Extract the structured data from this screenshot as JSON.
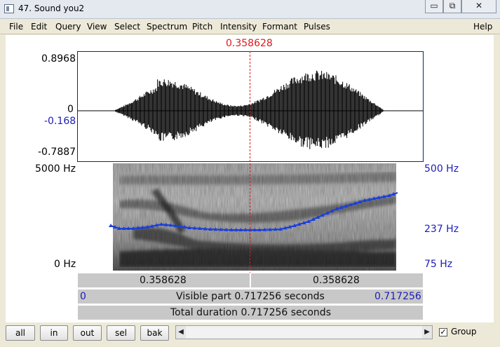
{
  "window": {
    "title": "47. Sound you2",
    "controls": [
      "▭",
      "⧉",
      "✕"
    ]
  },
  "menu": {
    "items": [
      "File",
      "Edit",
      "Query",
      "View",
      "Select",
      "Spectrum",
      "Pitch",
      "Intensity",
      "Formant",
      "Pulses"
    ],
    "help": "Help"
  },
  "cursor": {
    "time_label": "0.358628"
  },
  "waveform": {
    "max_label": "0.8968",
    "zero_label": "0",
    "cursor_value_label": "-0.168",
    "min_label": "-0.7887"
  },
  "spectrogram": {
    "freq_top_label": "5000 Hz",
    "freq_bottom_label": "0 Hz"
  },
  "pitch": {
    "top_label": "500 Hz",
    "mid_label": "237 Hz",
    "bottom_label": "75 Hz"
  },
  "bars": {
    "left_segment": "0.358628",
    "right_segment": "0.358628",
    "visible_start": "0",
    "visible_label": "Visible part 0.717256 seconds",
    "visible_end": "0.717256",
    "total_label": "Total duration 0.717256 seconds"
  },
  "bottom": {
    "buttons": [
      "all",
      "in",
      "out",
      "sel",
      "bak"
    ],
    "group_label": "Group",
    "group_checked": "✓",
    "scroll_left": "◀",
    "scroll_right": "▶"
  },
  "colors": {
    "pitch_line": "#1c3fd8",
    "cursor": "#e01818",
    "label_blue": "#1c1cb8"
  }
}
